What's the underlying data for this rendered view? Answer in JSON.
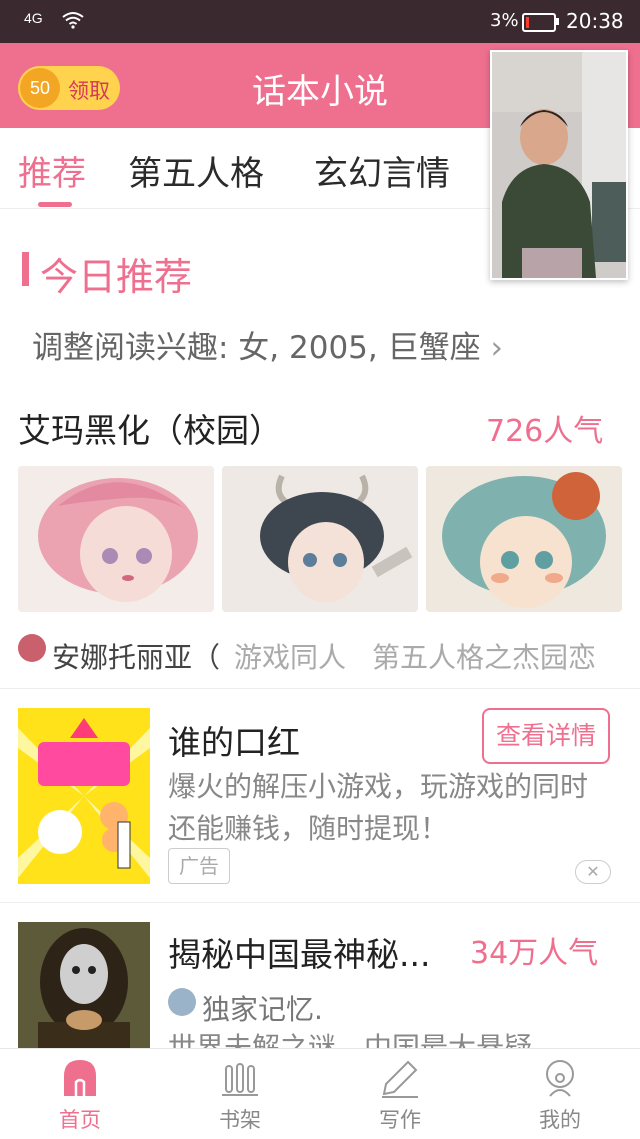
{
  "status_bar": {
    "signal": "4G",
    "battery": "3%",
    "time": "20:38"
  },
  "header": {
    "coins": "50",
    "claim_label": "领取",
    "title": "话本小说"
  },
  "tabs": [
    {
      "label": "推荐"
    },
    {
      "label": "第五人格"
    },
    {
      "label": "玄幻言情"
    }
  ],
  "today": {
    "section_title": "今日推荐",
    "interest_text": "调整阅读兴趣: 女, 2005, 巨蟹座",
    "book_title": "艾玛黑化（校园）",
    "popularity": "726人气",
    "tag_main": "安娜托丽亚（",
    "tag_1": "游戏同人",
    "tag_2": "第五人格之杰园恋"
  },
  "ad": {
    "title": "谁的口红",
    "button": "查看详情",
    "desc_line1": "爆火的解压小游戏，玩游戏的同时",
    "desc_line2": "还能赚钱，随时提现！",
    "label": "广告",
    "close": "✕"
  },
  "item2": {
    "title": "揭秘中国最神秘...",
    "popularity": "34万人气",
    "author": "独家记忆.",
    "desc": "世界未解之谜，中国最大悬疑"
  },
  "bottom_nav": [
    {
      "label": "首页",
      "icon": "home-icon"
    },
    {
      "label": "书架",
      "icon": "bookshelf-icon"
    },
    {
      "label": "写作",
      "icon": "pen-icon"
    },
    {
      "label": "我的",
      "icon": "profile-icon"
    }
  ],
  "colors": {
    "accent": "#ef6f8f",
    "status_bar": "#3a2a30",
    "coin": "#ffd34d"
  }
}
